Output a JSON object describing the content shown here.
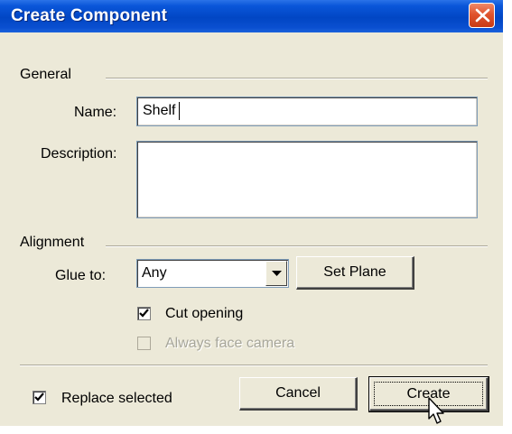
{
  "dialog": {
    "title": "Create Component",
    "close_icon": "close-icon"
  },
  "general": {
    "group_label": "General",
    "name_label": "Name:",
    "name_value": "Shelf",
    "description_label": "Description:",
    "description_value": ""
  },
  "alignment": {
    "group_label": "Alignment",
    "glue_label": "Glue to:",
    "glue_value": "Any",
    "set_plane_label": "Set Plane",
    "cut_opening_label": "Cut opening",
    "cut_opening_checked": true,
    "always_face_camera_label": "Always face camera",
    "always_face_camera_checked": false,
    "always_face_camera_enabled": false
  },
  "footer": {
    "replace_selected_label": "Replace selected",
    "replace_selected_checked": true,
    "cancel_label": "Cancel",
    "create_label": "Create"
  },
  "colors": {
    "dialog_bg": "#ECE9D8",
    "titlebar_blue": "#0146C4",
    "close_red": "#E0542E"
  }
}
